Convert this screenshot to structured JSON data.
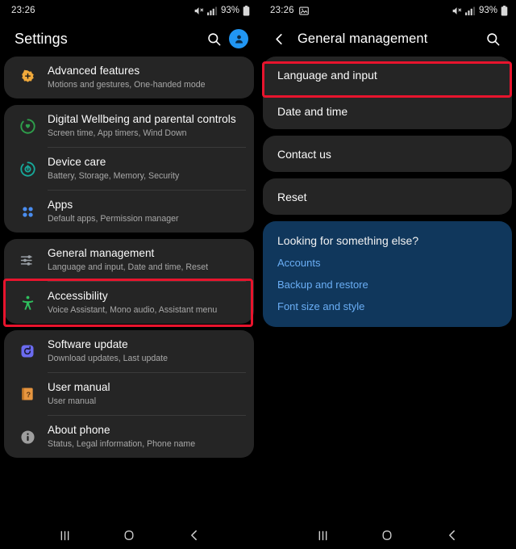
{
  "left": {
    "statusbar": {
      "time": "23:26",
      "battery_pct": "93%",
      "icons": [
        "mute-icon",
        "signal-bars-icon",
        "battery-icon"
      ]
    },
    "appbar": {
      "title": "Settings",
      "search_icon": "search-icon",
      "avatar_icon": "account-avatar-icon"
    },
    "cards": [
      {
        "rows": [
          {
            "icon": "advanced-features-icon",
            "icon_color": "#f0a93b",
            "title": "Advanced features",
            "subtitle": "Motions and gestures, One-handed mode"
          }
        ]
      },
      {
        "rows": [
          {
            "icon": "digital-wellbeing-icon",
            "icon_color": "#2e9e4b",
            "title": "Digital Wellbeing and parental controls",
            "subtitle": "Screen time, App timers, Wind Down"
          },
          {
            "icon": "device-care-icon",
            "icon_color": "#17a99a",
            "title": "Device care",
            "subtitle": "Battery, Storage, Memory, Security"
          },
          {
            "icon": "apps-icon",
            "icon_color": "#4a8df0",
            "title": "Apps",
            "subtitle": "Default apps, Permission manager"
          }
        ]
      },
      {
        "rows": [
          {
            "icon": "general-management-icon",
            "icon_color": "#9aa0a6",
            "title": "General management",
            "subtitle": "Language and input, Date and time, Reset"
          },
          {
            "icon": "accessibility-icon",
            "icon_color": "#2fbf5e",
            "title": "Accessibility",
            "subtitle": "Voice Assistant, Mono audio, Assistant menu"
          }
        ]
      },
      {
        "rows": [
          {
            "icon": "software-update-icon",
            "icon_color": "#6b6bf0",
            "title": "Software update",
            "subtitle": "Download updates, Last update"
          },
          {
            "icon": "user-manual-icon",
            "icon_color": "#e6953f",
            "title": "User manual",
            "subtitle": "User manual"
          },
          {
            "icon": "about-phone-icon",
            "icon_color": "#9e9e9e",
            "title": "About phone",
            "subtitle": "Status, Legal information, Phone name"
          }
        ]
      }
    ],
    "highlight": {
      "target": "General management",
      "color": "#e8142d"
    },
    "navbar": {
      "recents": "recents-icon",
      "home": "home-icon",
      "back": "back-icon"
    }
  },
  "right": {
    "statusbar": {
      "time": "23:26",
      "battery_pct": "93%",
      "icons": [
        "screenshot-image-icon",
        "mute-icon",
        "signal-bars-icon",
        "battery-icon"
      ]
    },
    "appbar": {
      "back_icon": "back-arrow-icon",
      "title": "General management",
      "search_icon": "search-icon"
    },
    "cards": [
      {
        "rows": [
          {
            "label": "Language and input"
          },
          {
            "label": "Date and time"
          }
        ]
      },
      {
        "rows": [
          {
            "label": "Contact us"
          }
        ]
      },
      {
        "rows": [
          {
            "label": "Reset"
          }
        ]
      }
    ],
    "info": {
      "heading": "Looking for something else?",
      "links": [
        "Accounts",
        "Backup and restore",
        "Font size and style"
      ],
      "bg_color": "#10375c",
      "link_color": "#6aaef5"
    },
    "highlight": {
      "target": "Language and input",
      "color": "#e8142d"
    },
    "navbar": {
      "recents": "recents-icon",
      "home": "home-icon",
      "back": "back-icon"
    }
  }
}
